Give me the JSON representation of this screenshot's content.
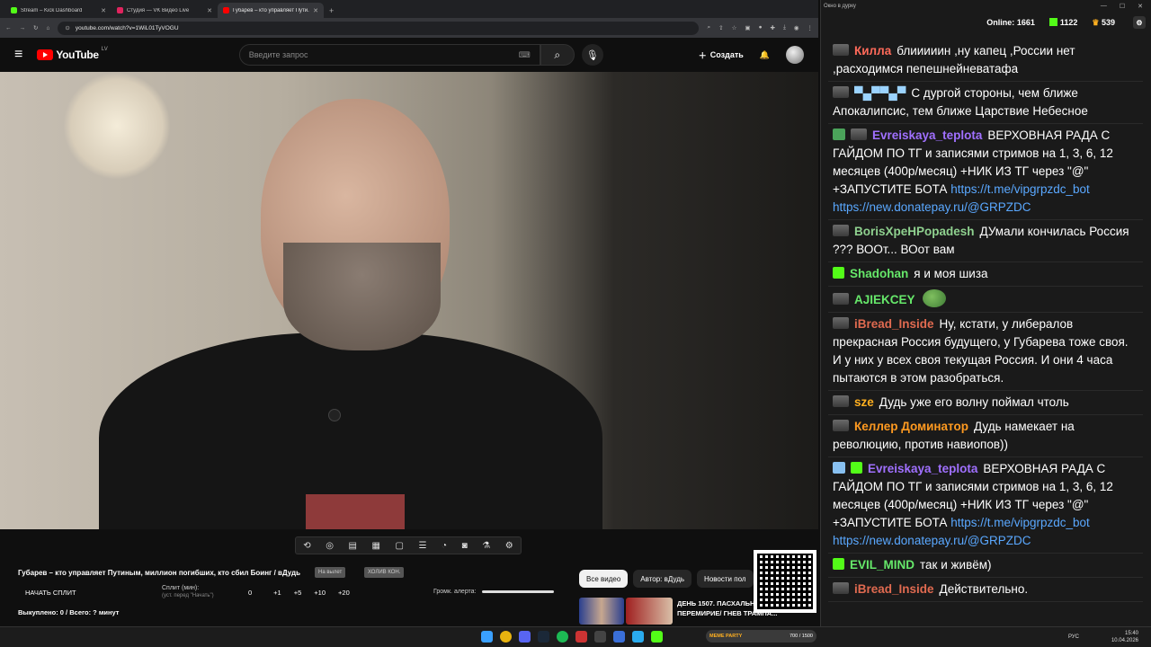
{
  "browser": {
    "tabs": [
      {
        "title": "Stream – Kick Dashboard",
        "color": "#53fc18"
      },
      {
        "title": "Студия — VK Видео Live",
        "color": "#e0245e"
      },
      {
        "title": "Губарев – кто управляет Пути...",
        "color": "#ff0000"
      }
    ],
    "new_tab": "+",
    "url": "youtube.com/watch?v=1WiL01TyVOGU"
  },
  "youtube": {
    "logo": "YouTube",
    "region": "LV",
    "search_placeholder": "Введите запрос",
    "create_label": "Создать"
  },
  "video": {
    "title": "Губарев – кто управляет Путиным, миллион погибших, кто сбил Боинг / вДудь",
    "pill1": "На вылет",
    "pill2": "ХОЛИВ КОН.",
    "split_button": "НАЧАТЬ СПЛИТ",
    "split_label": "Сплит (мин):",
    "split_hint": "(уст. перед \"Начать\")",
    "split_values": [
      "0",
      "+1",
      "+5",
      "+10",
      "+20"
    ],
    "alert_volume_label": "Громк. алерта:",
    "bought": "Выкуплено: 0 / Всего: ? минут",
    "chips": [
      "Все видео",
      "Автор: вДудь",
      "Новости пол"
    ],
    "rec_title": "ДЕНЬ 1507. ПАСХАЛЬНОЕ ПЕРЕМИРИЕ/ ГНЕВ ТРАМПА..."
  },
  "chat": {
    "window_title": "Окно в дурку",
    "online_label": "Online:",
    "online": "1661",
    "kick_count": "1122",
    "other_count": "539",
    "messages": [
      {
        "nick": "Килла",
        "color": "#ff6a5a",
        "badge": "g",
        "text": "блииииин ,ну капец ,России нет ,расходимся пепешнейневатафа"
      },
      {
        "nick": "▀▄▀▀▄▀",
        "color": "#9bd3ff",
        "badge": "g",
        "text": "С дургой стороны, чем ближе Апокалипсис, тем ближе Царствие Небесное"
      },
      {
        "nick": "Evreiskaya_teplota",
        "color": "#a070ff",
        "badge": "g2",
        "text": "ВЕРХОВНАЯ РАДА С ГАЙДОМ ПО ТГ и записями стримов на 1, 3, 6, 12 месяцев (400р/месяц) +НИК ИЗ ТГ через \"@\" +ЗАПУСТИТЕ БОТА",
        "link1": "https://t.me/vipgrpzdc_bot",
        "link2": "https://new.donatepay.ru/@GRPZDC"
      },
      {
        "nick": "BorisXpeHPopadesh",
        "color": "#8fd18f",
        "badge": "g",
        "text": "ДУмали кончилась Россия ??? ВООт... ВОот вам"
      },
      {
        "nick": "Shadohan",
        "color": "#66e86a",
        "badge": "k",
        "text": "я и моя шиза"
      },
      {
        "nick": "AJIEKCEY",
        "color": "#66e86a",
        "badge": "g",
        "text": ""
      },
      {
        "nick": "iBread_Inside",
        "color": "#e06a50",
        "badge": "g",
        "text": "Ну, кстати, у либералов прекрасная Россия будущего, у Губарева тоже своя. И у них у всех своя текущая Россия. И они 4 часа пытаются в этом разобраться."
      },
      {
        "nick": "sze",
        "color": "#ffb020",
        "badge": "g",
        "text": "Дудь уже его волну поймал чтоль"
      },
      {
        "nick": "Келлер Доминатор",
        "color": "#ff9a20",
        "badge": "g",
        "text": "Дудь намекает на революцию, против навиопов))"
      },
      {
        "nick": "Evreiskaya_teplota",
        "color": "#a070ff",
        "badge": "s",
        "text": "ВЕРХОВНАЯ РАДА С ГАЙДОМ ПО ТГ и записями стримов на 1, 3, 6, 12 месяцев (400р/месяц) +НИК ИЗ ТГ через \"@\" +ЗАПУСТИТЕ БОТА",
        "link1": "https://t.me/vipgrpzdc_bot",
        "link2": "https://new.donatepay.ru/@GRPZDC"
      },
      {
        "nick": "EVIL_MIND",
        "color": "#66e86a",
        "badge": "k",
        "text": "так и живём)"
      },
      {
        "nick": "iBread_Inside",
        "color": "#e06a50",
        "badge": "g",
        "text": "Действительно."
      }
    ]
  },
  "taskbar": {
    "lang": "РУС",
    "time": "15:40",
    "date": "10.04.2026",
    "widget_left": "MEME PARTY",
    "widget_right": "700 / 1500"
  }
}
